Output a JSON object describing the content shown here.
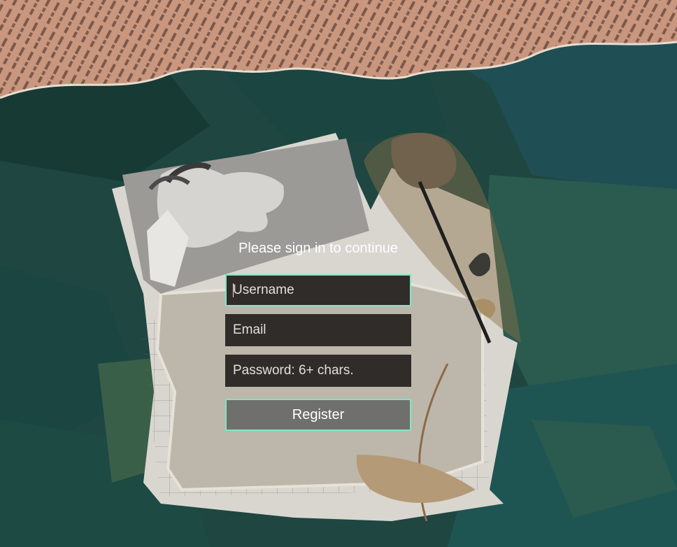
{
  "form": {
    "heading": "Please sign in to continue",
    "username_placeholder": "Username",
    "email_placeholder": "Email",
    "password_placeholder": "Password: 6+ chars.",
    "register_label": "Register"
  },
  "colors": {
    "field_bg": "#2f2c29",
    "focus_border": "#7fe6c3",
    "button_bg": "#6f6f6d",
    "heading_text": "#ffffff"
  }
}
